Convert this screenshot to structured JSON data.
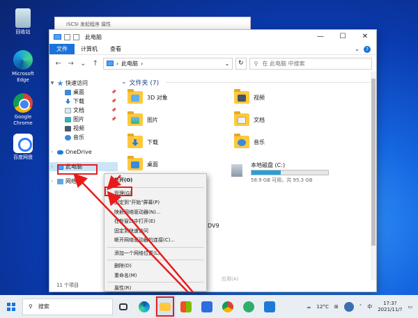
{
  "desktop_icons": [
    {
      "label": "回收站",
      "icon": "recycle-bin-icon"
    },
    {
      "label": "Microsoft Edge",
      "icon": "edge-icon"
    },
    {
      "label": "Google Chrome",
      "icon": "chrome-icon"
    },
    {
      "label": "百度网盘",
      "icon": "baidu-netdisk-icon"
    }
  ],
  "background_window": {
    "title": "iSCSI 发起程序 属性"
  },
  "explorer": {
    "title": "此电脑",
    "window_controls": {
      "minimize": "—",
      "maximize": "☐",
      "close": "✕"
    },
    "ribbon": {
      "file": "文件",
      "computer": "计算机",
      "view": "查看",
      "expand": "⌄",
      "help": "?"
    },
    "nav": {
      "back": "←",
      "forward": "→",
      "recent": "⌄",
      "up": "↑"
    },
    "address": {
      "path": "此电脑",
      "separator": "›",
      "dropdown": "⌄"
    },
    "refresh": "↻",
    "search": {
      "placeholder": "在 此电脑 中搜索"
    },
    "sidebar": {
      "quick_access": "快速访问",
      "items": [
        {
          "label": "桌面",
          "pin": "📌"
        },
        {
          "label": "下载",
          "pin": "📌"
        },
        {
          "label": "文档",
          "pin": "📌"
        },
        {
          "label": "图片",
          "pin": "📌"
        },
        {
          "label": "视频"
        },
        {
          "label": "音乐"
        }
      ],
      "onedrive": "OneDrive",
      "this_pc": "此电脑",
      "network": "网络"
    },
    "folders_header": "文件夹 (7)",
    "folders": [
      "3D 对象",
      "视频",
      "图片",
      "文档",
      "下载",
      "音乐",
      "桌面"
    ],
    "drive": {
      "name": "本地磁盘 (C:)",
      "free": "58.9 GB 可用，共 95.3 GB",
      "used_fraction": 0.38
    },
    "partial_label": "DV9",
    "status": "11 个项目",
    "partial_button": "应用(A)"
  },
  "context_menu": {
    "items": [
      "打开(O)",
      "管理(G)",
      "固定到\"开始\"屏幕(P)",
      "映射网络驱动器(N)...",
      "在新窗口中打开(E)",
      "固定到快速访问",
      "断开网络驱动器的连接(C)...",
      "添加一个网络位置(L)",
      "删除(D)",
      "重命名(M)",
      "属性(R)"
    ]
  },
  "taskbar": {
    "search": "搜索",
    "weather": "12°C",
    "ime": "中",
    "time": "17:3?",
    "date": "2021/11/?"
  },
  "colors": {
    "accent": "#1a73d9",
    "highlight": "#e81b1b"
  }
}
